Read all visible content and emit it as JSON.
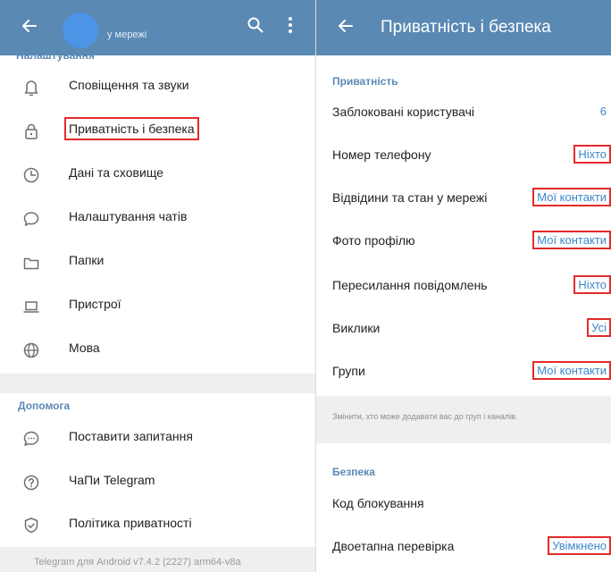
{
  "left_panel": {
    "header": {
      "status": "у мережі",
      "cut_section_title": "Налаштування"
    },
    "settings_items": [
      {
        "icon": "bell-icon",
        "label": "Сповіщення та звуки"
      },
      {
        "icon": "lock-icon",
        "label": "Приватність і безпека",
        "highlighted": true
      },
      {
        "icon": "clock-icon",
        "label": "Дані та сховище"
      },
      {
        "icon": "chat-bubble-icon",
        "label": "Налаштування чатів"
      },
      {
        "icon": "folder-icon",
        "label": "Папки"
      },
      {
        "icon": "laptop-icon",
        "label": "Пристрої"
      },
      {
        "icon": "globe-icon",
        "label": "Мова"
      }
    ],
    "help_section": {
      "title": "Допомога",
      "items": [
        {
          "icon": "chat-dots-icon",
          "label": "Поставити запитання"
        },
        {
          "icon": "question-icon",
          "label": "ЧаПи Telegram"
        },
        {
          "icon": "shield-check-icon",
          "label": "Політика приватності"
        }
      ]
    },
    "footer": "Telegram для Android v7.4.2 (2227) arm64-v8a"
  },
  "right_panel": {
    "header": {
      "title": "Приватність і безпека"
    },
    "privacy_section": {
      "title": "Приватність",
      "rows": [
        {
          "label": "Заблоковані користувачі",
          "value": "6",
          "highlighted": false
        },
        {
          "label": "Номер телефону",
          "value": "Ніхто",
          "highlighted": true
        },
        {
          "label": "Відвідини та стан у мережі",
          "value": "Мої контакти",
          "highlighted": true
        },
        {
          "label": "Фото профілю",
          "value": "Мої контакти",
          "highlighted": true
        },
        {
          "label": "Пересилання повідомлень",
          "value": "Ніхто",
          "highlighted": true
        },
        {
          "label": "Виклики",
          "value": "Усі",
          "highlighted": true
        },
        {
          "label": "Групи",
          "value": "Мої контакти",
          "highlighted": true
        }
      ],
      "note": "Змінити, хто може додавати вас до груп і каналів."
    },
    "security_section": {
      "title": "Безпека",
      "rows": [
        {
          "label": "Код блокування",
          "value": ""
        },
        {
          "label": "Двоетапна перевірка",
          "value": "Увімкнено",
          "highlighted": true
        }
      ]
    }
  },
  "colors": {
    "header_bg": "#5a89b4",
    "accent_blue": "#3d87c9",
    "highlight_red": "#e32b2b",
    "section_gray": "#efefef"
  }
}
